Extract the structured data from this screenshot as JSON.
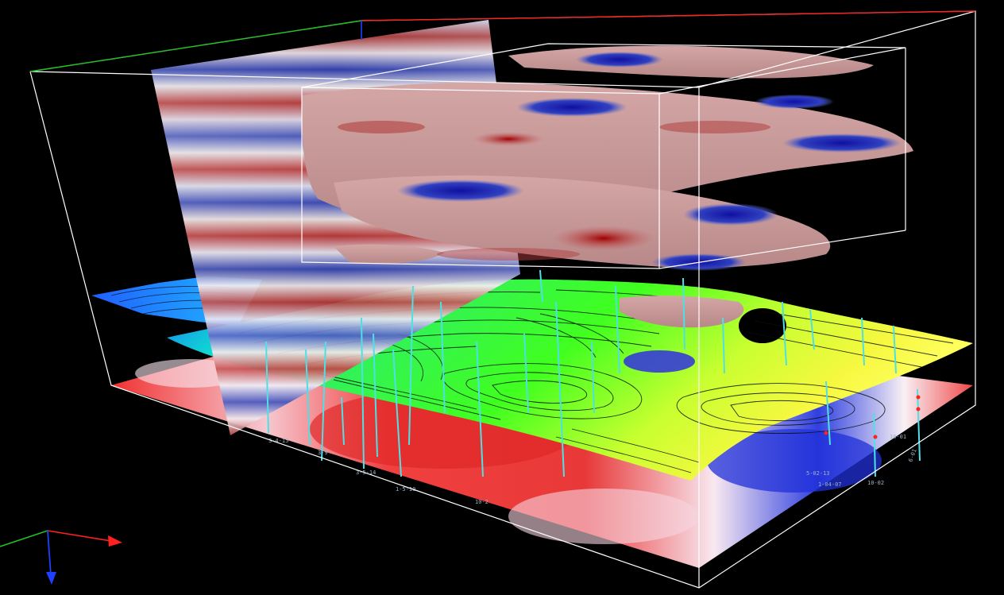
{
  "viewport": {
    "background": "#000000",
    "colors": {
      "box_outline": "#ffffff",
      "axis_x": "#ff2020",
      "axis_y": "#20c020",
      "axis_z": "#2040ff",
      "well": "#4fe0e6",
      "seismic_positive": "#b02020",
      "seismic_negative": "#1a2aa0",
      "horizon_low": "#1040ff",
      "horizon_mid": "#20e020",
      "horizon_high": "#f0f030",
      "isosurface": "#c89a98"
    },
    "icons": [
      "orientation-axes-icon"
    ],
    "well_labels": [
      "3-4-15",
      "3-9",
      "3-5-14",
      "1-5-10",
      "10-2",
      "1-04-07",
      "10-02",
      "10-01",
      "6-01",
      "5-02-13"
    ]
  }
}
